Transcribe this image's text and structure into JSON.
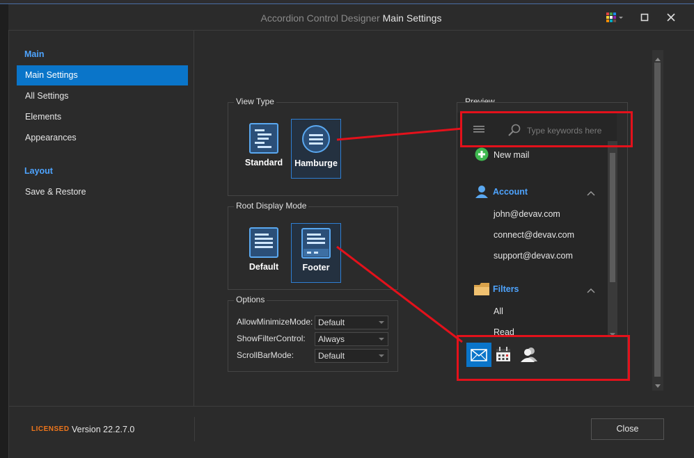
{
  "window": {
    "title_prefix": "Accordion Control Designer",
    "title_main": "Main Settings"
  },
  "nav": {
    "groups": [
      {
        "label": "Main",
        "items": [
          "Main Settings",
          "All Settings",
          "Elements",
          "Appearances"
        ]
      },
      {
        "label": "Layout",
        "items": [
          "Save & Restore"
        ]
      }
    ],
    "active": "Main Settings"
  },
  "view_type": {
    "label": "View Type",
    "options": [
      "Standard",
      "Hamburge"
    ],
    "selected": "Hamburge"
  },
  "root_display_mode": {
    "label": "Root Display Mode",
    "options": [
      "Default",
      "Footer"
    ],
    "selected": "Footer"
  },
  "options": {
    "label": "Options",
    "rows": [
      {
        "label": "AllowMinimizeMode:",
        "value": "Default"
      },
      {
        "label": "ShowFilterControl:",
        "value": "Always"
      },
      {
        "label": "ScrollBarMode:",
        "value": "Default"
      }
    ]
  },
  "preview": {
    "label": "Preview",
    "search_placeholder": "Type keywords here",
    "new_mail": "New mail",
    "account_group": "Account",
    "account_items": [
      "john@devav.com",
      "connect@devav.com",
      "support@devav.com"
    ],
    "filters_group": "Filters",
    "filter_items": [
      "All",
      "Read"
    ],
    "footer_icons": [
      "mail-icon",
      "calendar-icon",
      "contacts-icon"
    ]
  },
  "footer": {
    "licensed": "LICENSED",
    "version": "Version 22.2.7.0",
    "close_label": "Close"
  },
  "colors": {
    "accent": "#0a75c9",
    "group_text": "#4ea4ff",
    "annotation": "#e3111b",
    "licensed": "#f0761b"
  }
}
